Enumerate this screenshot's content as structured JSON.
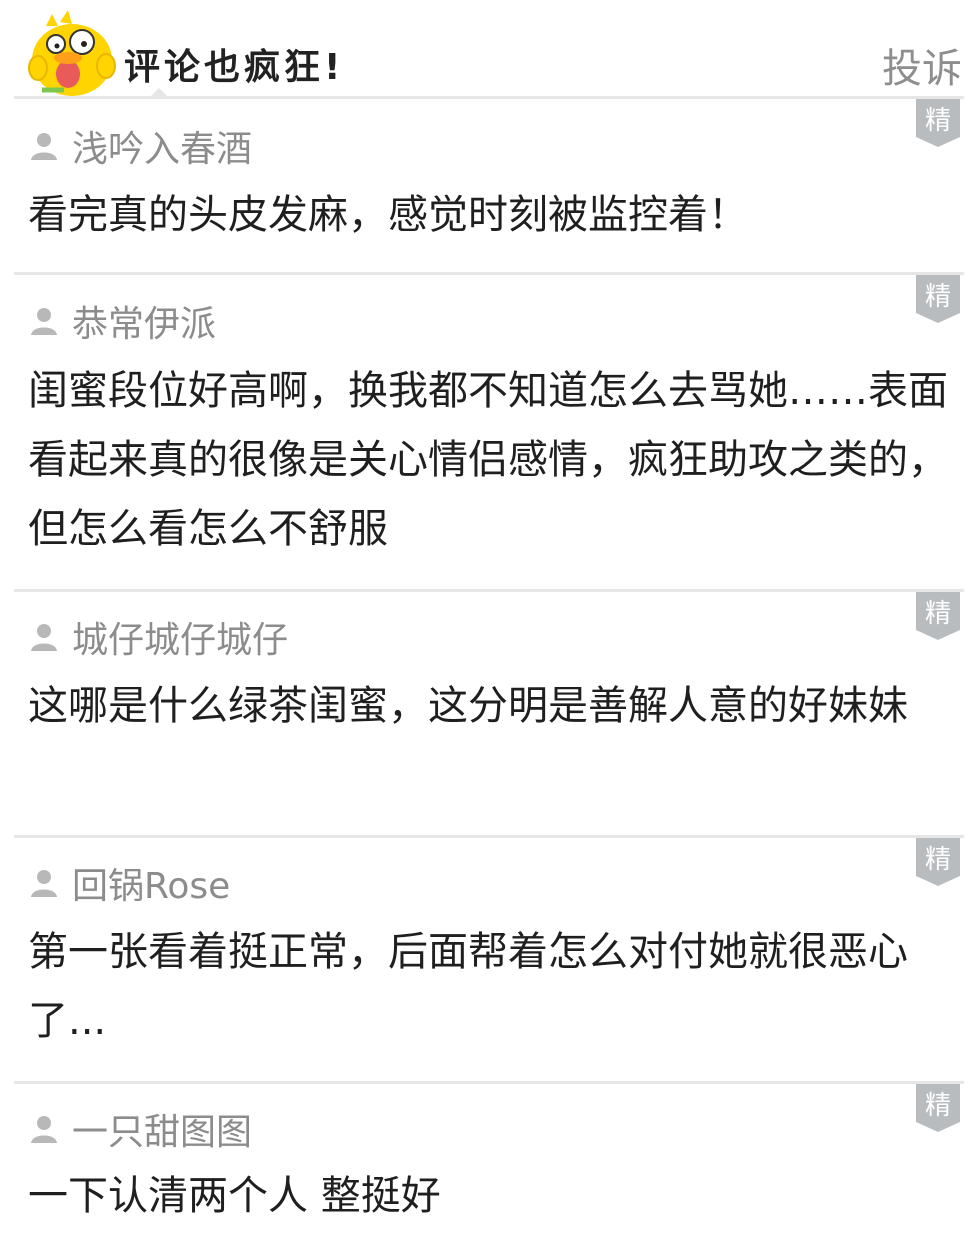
{
  "header": {
    "title": "评论也疯狂!",
    "report_label": "投诉",
    "mascot_icon": "yellow-duck-mascot-icon"
  },
  "badge_label": "精",
  "comments": [
    {
      "user": "浅吟入春酒",
      "text": "看完真的头皮发麻，感觉时刻被监控着！"
    },
    {
      "user": "恭常伊派",
      "text": "闺蜜段位好高啊，换我都不知道怎么去骂她……表面看起来真的很像是关心情侣感情，疯狂助攻之类的，但怎么看怎么不舒服"
    },
    {
      "user": "城仔城仔城仔",
      "text": "这哪是什么绿茶闺蜜，这分明是善解人意的好妹妹"
    },
    {
      "user": "回锅Rose",
      "text": "第一张看着挺正常，后面帮着怎么对付她就很恶心了..."
    },
    {
      "user": "一只甜图图",
      "text": "一下认清两个人 整挺好"
    }
  ],
  "colors": {
    "separator": "#e6e6e6",
    "username": "#8c8c8c",
    "body": "#1f1f1f",
    "badge": "#b9bcbf",
    "mascot": "#ffd400"
  }
}
